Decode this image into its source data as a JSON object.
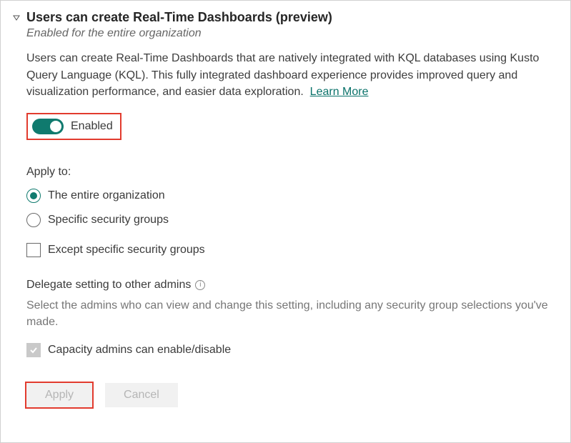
{
  "header": {
    "title": "Users can create Real-Time Dashboards (preview)",
    "subtitle": "Enabled for the entire organization"
  },
  "description": "Users can create Real-Time Dashboards that are natively integrated with KQL databases using Kusto Query Language (KQL). This fully integrated dashboard experience provides improved query and visualization performance, and easier data exploration.",
  "learn_more": "Learn More",
  "toggle": {
    "label": "Enabled"
  },
  "apply_to": {
    "label": "Apply to:",
    "options": {
      "entire_org": "The entire organization",
      "specific_groups": "Specific security groups"
    },
    "except_label": "Except specific security groups"
  },
  "delegate": {
    "label": "Delegate setting to other admins",
    "description": "Select the admins who can view and change this setting, including any security group selections you've made.",
    "capacity_label": "Capacity admins can enable/disable"
  },
  "buttons": {
    "apply": "Apply",
    "cancel": "Cancel"
  }
}
